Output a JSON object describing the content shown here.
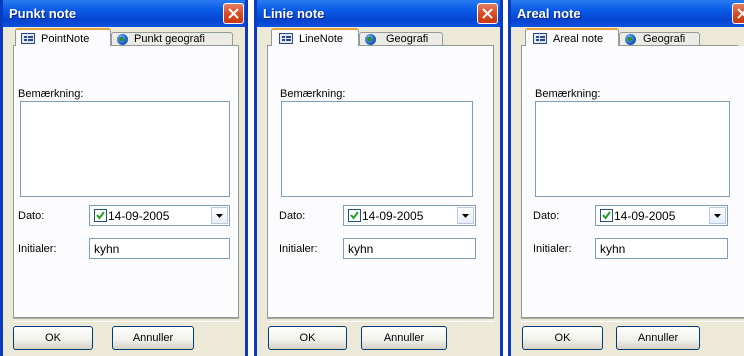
{
  "windows": [
    {
      "title": "Punkt note",
      "tabs": [
        "PointNote",
        "Punkt geografi"
      ],
      "remark_label": "Bemærkning:",
      "date_label": "Dato:",
      "date_value": "14-09-2005",
      "date_checked": true,
      "initials_label": "Initialer:",
      "initials_value": "kyhn",
      "ok_label": "OK",
      "cancel_label": "Annuller"
    },
    {
      "title": "Linie note",
      "tabs": [
        "LineNote",
        "Geografi"
      ],
      "remark_label": "Bemærkning:",
      "date_label": "Dato:",
      "date_value": "14-09-2005",
      "date_checked": true,
      "initials_label": "Initialer:",
      "initials_value": "kyhn",
      "ok_label": "OK",
      "cancel_label": "Annuller"
    },
    {
      "title": "Areal note",
      "tabs": [
        "Areal note",
        "Geografi"
      ],
      "remark_label": "Bemærkning:",
      "date_label": "Dato:",
      "date_value": "14-09-2005",
      "date_checked": true,
      "initials_label": "Initialer:",
      "initials_value": "kyhn",
      "ok_label": "OK",
      "cancel_label": "Annuller"
    }
  ],
  "icons": {
    "close": "close-icon",
    "form_tab": "form-icon",
    "geography_tab": "globe-icon",
    "dropdown": "chevron-down-icon",
    "checkbox": "checkmark-icon"
  },
  "colors": {
    "titlebar": "#0a5ce8",
    "window_border": "#0a3bbf",
    "dialog_bg": "#ece9d8",
    "close_button": "#d9471e",
    "active_tab_accent": "#e6a33c"
  }
}
